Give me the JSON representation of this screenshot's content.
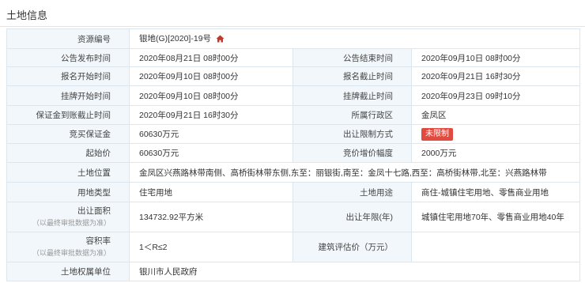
{
  "section_title": "土地信息",
  "rows": {
    "resource_no": {
      "label": "资源编号",
      "value": "银地(G)[2020]-19号"
    },
    "announce_start": {
      "label": "公告发布时间",
      "value": "2020年08月21日 08时00分"
    },
    "announce_end": {
      "label": "公告结束时间",
      "value": "2020年09月10日 08时00分"
    },
    "signup_start": {
      "label": "报名开始时间",
      "value": "2020年09月10日 08时00分"
    },
    "signup_end": {
      "label": "报名截止时间",
      "value": "2020年09月21日 16时30分"
    },
    "listing_start": {
      "label": "挂牌开始时间",
      "value": "2020年09月10日 08时00分"
    },
    "listing_end": {
      "label": "挂牌截止时间",
      "value": "2020年09月23日 09时10分"
    },
    "deposit_deadline": {
      "label": "保证金到账截止时间",
      "value": "2020年09月21日 16时30分"
    },
    "district": {
      "label": "所属行政区",
      "value": "金凤区"
    },
    "deposit": {
      "label": "竞买保证金",
      "value": "60630万元"
    },
    "restriction": {
      "label": "出让限制方式",
      "value": "未限制"
    },
    "start_price": {
      "label": "起始价",
      "value": "60630万元"
    },
    "increment": {
      "label": "竞价增价幅度",
      "value": "2000万元"
    },
    "location": {
      "label": "土地位置",
      "value": "金凤区兴燕路林带南侧、高桥街林带东侧,东至：丽银街,南至：金凤十七路,西至：高桥街林带,北至：兴燕路林带"
    },
    "land_type": {
      "label": "用地类型",
      "value": "住宅用地"
    },
    "land_use": {
      "label": "土地用途",
      "value": "商住-城镇住宅用地、零售商业用地"
    },
    "area": {
      "label": "出让面积",
      "note": "（以最终审批数据为准）",
      "value": "134732.92平方米"
    },
    "term": {
      "label": "出让年限(年)",
      "value": "城镇住宅用地70年、零售商业用地40年"
    },
    "plot_ratio": {
      "label": "容积率",
      "note": "（以最终审批数据为准）",
      "value": "1＜R≤2"
    },
    "valuation": {
      "label": "建筑评估价（万元）",
      "value": ""
    },
    "owner": {
      "label": "土地权属单位",
      "value": "银川市人民政府"
    }
  },
  "colors": {
    "label_bg": "#f1f7fb",
    "border": "#dce6ee",
    "home_icon": "#c0392b",
    "badge_bg": "#e04a3f"
  }
}
